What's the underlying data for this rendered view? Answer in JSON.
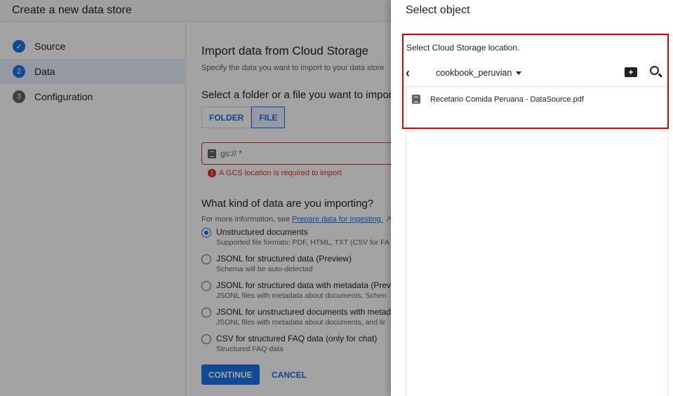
{
  "header": {
    "title": "Create a new data store"
  },
  "steps": [
    {
      "num": "✓",
      "label": "Source"
    },
    {
      "num": "2",
      "label": "Data"
    },
    {
      "num": "3",
      "label": "Configuration"
    }
  ],
  "main": {
    "title": "Import data from Cloud Storage",
    "subtitle": "Specify the data you want to import to your data store",
    "select_heading": "Select a folder or a file you want to import",
    "toggle": [
      "FOLDER",
      "FILE"
    ],
    "gcs_placeholder": "gs:// *",
    "error": "A GCS location is required to import",
    "kind_heading": "What kind of data are you importing?",
    "info_prefix": "For more information, see ",
    "info_link": "Prepare data for ingesting.",
    "options": [
      {
        "label": "Unstructured documents",
        "desc": "Supported file formats: PDF, HTML, TXT (CSV for FA",
        "selected": true
      },
      {
        "label": "JSONL for structured data (Preview)",
        "desc": "Schema will be auto-detected"
      },
      {
        "label": "JSONL for structured data with metadata (Previe",
        "desc": "JSONL files with metadata about documents. Schen"
      },
      {
        "label": "JSONL for unstructured documents with metada",
        "desc": "JSONL files with metadata about documents, and lir"
      },
      {
        "label": "CSV for structured FAQ data (only for chat)",
        "desc": "Structured FAQ data"
      }
    ],
    "continue": "CONTINUE",
    "cancel": "CANCEL"
  },
  "panel": {
    "title": "Select object",
    "label": "Select Cloud Storage location.",
    "bucket": "cookbook_peruvian",
    "files": [
      "Recetario Comida Peruana - DataSource.pdf"
    ],
    "highlight_color": "#e00000"
  }
}
